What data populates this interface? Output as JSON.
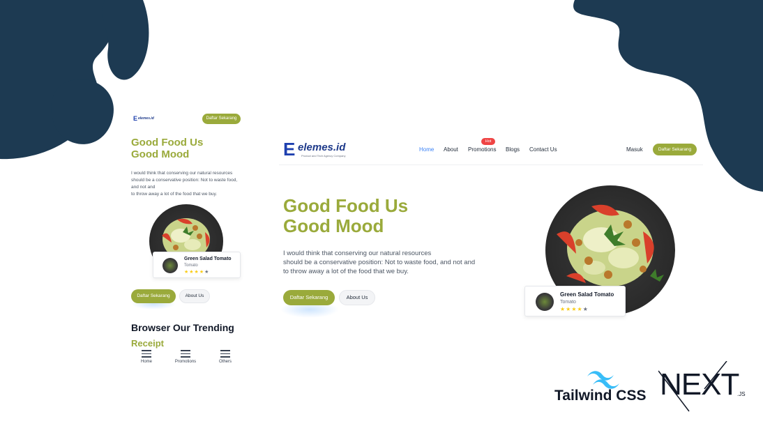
{
  "colors": {
    "accent": "#9aaa3b",
    "blob": "#1d3a52",
    "nav_active": "#3b82f6",
    "badge": "#ef4444"
  },
  "brand": {
    "name": "elemes.id",
    "tagline": "Product and Tech Agency Company",
    "mark": "E"
  },
  "mobile": {
    "header_button": "Daftar Sekarang",
    "headline": [
      "Good Food Us",
      "Good Mood"
    ],
    "paragraph": [
      "I would think that conserving our natural resources",
      "should be a conservative position: Not to waste food,",
      "and not and",
      "to throw away a lot of the food that we buy."
    ],
    "food_card": {
      "title": "Green Salad Tomato",
      "subtitle": "Tomato",
      "stars": "★★★★",
      "stars_off": "★"
    },
    "cta_primary": "Daftar Sekarang",
    "cta_secondary": "About Us",
    "trending_title": "Browser Our Trending",
    "trending_accent": "Receipt",
    "bottom_nav": [
      {
        "label": "Home",
        "icon": "menu-icon"
      },
      {
        "label": "Promotions",
        "icon": "menu-icon"
      },
      {
        "label": "Others",
        "icon": "menu-icon"
      }
    ]
  },
  "desktop": {
    "nav": [
      {
        "label": "Home",
        "active": true
      },
      {
        "label": "About"
      },
      {
        "label": "Promotions",
        "badge": "Hot"
      },
      {
        "label": "Blogs"
      },
      {
        "label": "Contact Us"
      }
    ],
    "login": "Masuk",
    "register": "Daftar Sekarang",
    "headline": [
      "Good Food Us",
      "Good Mood"
    ],
    "paragraph": [
      "I would think that conserving our natural resources",
      "should be a conservative position: Not to waste food, and not and",
      "to throw away a lot of the food that we buy."
    ],
    "cta_primary": "Daftar Sekarang",
    "cta_secondary": "About Us",
    "food_card": {
      "title": "Green Salad Tomato",
      "subtitle": "Tomato",
      "stars": "★★★★",
      "stars_off": "★"
    }
  },
  "tech": {
    "tailwind": "Tailwind CSS",
    "next": "NEXT",
    "next_suffix": ".JS"
  }
}
